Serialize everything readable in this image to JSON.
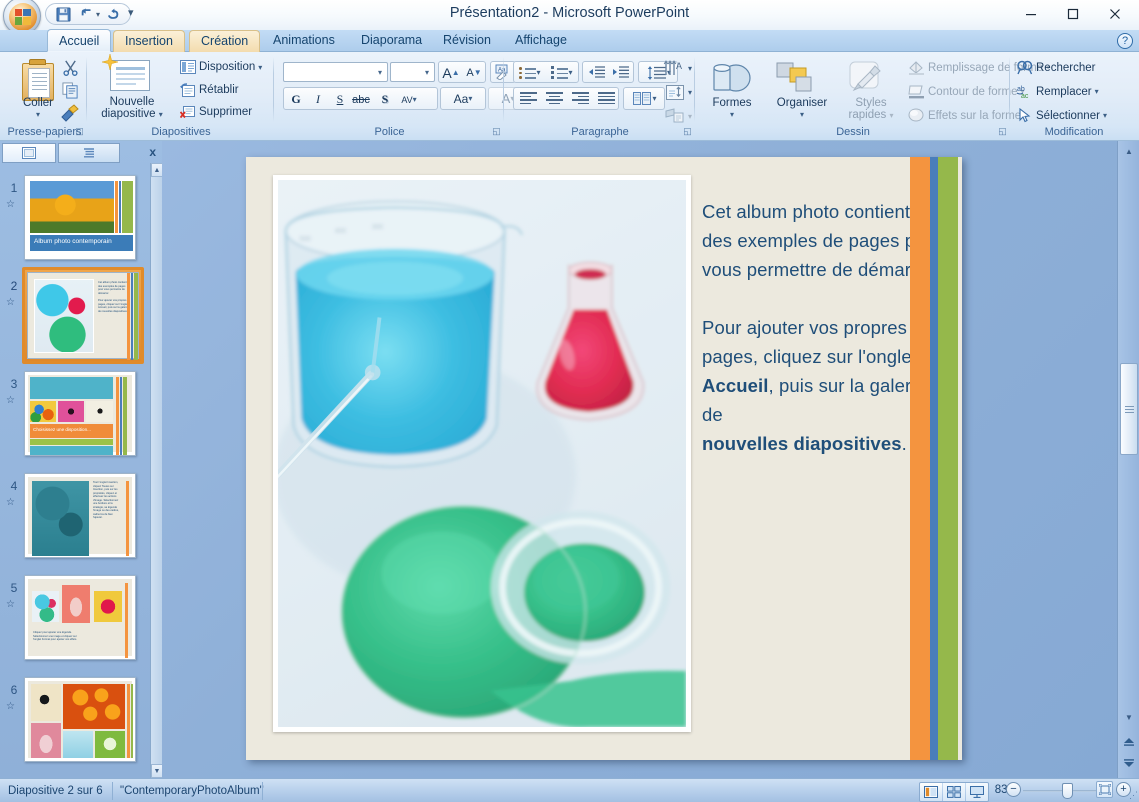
{
  "window": {
    "title": "Présentation2 - Microsoft PowerPoint",
    "minimize": "–",
    "maximize": "❐",
    "close": "✕",
    "help": "?"
  },
  "quick_access": {
    "save": "save-icon",
    "undo": "↰",
    "undo_dropdown": "▾",
    "redo": "↻",
    "customize": "▾"
  },
  "tabs": [
    {
      "label": "Accueil",
      "state": "active"
    },
    {
      "label": "Insertion",
      "state": "amber"
    },
    {
      "label": "Création",
      "state": "amber"
    },
    {
      "label": "Animations",
      "state": "normal"
    },
    {
      "label": "Diaporama",
      "state": "normal"
    },
    {
      "label": "Révision",
      "state": "normal"
    },
    {
      "label": "Affichage",
      "state": "normal"
    }
  ],
  "ribbon": {
    "groups": [
      {
        "name": "Presse-papiers",
        "label": "Presse-papiers",
        "paste": "Coller",
        "paste_caret": "▾",
        "cut": "scissors-icon",
        "copy": "copy-icon",
        "format_painter": "format-painter-icon",
        "dialog_launcher": "◱"
      },
      {
        "name": "Diapositives",
        "label": "Diapositives",
        "new_slide_line1": "Nouvelle",
        "new_slide_line2": "diapositive",
        "new_slide_caret": "▾",
        "layout": "Disposition",
        "layout_caret": "▾",
        "reset": "Rétablir",
        "delete": "Supprimer"
      },
      {
        "name": "Police",
        "label": "Police",
        "font_name_value": "",
        "font_size_value": "",
        "grow_font": "A",
        "shrink_font": "A",
        "clear_formatting": "clear-formatting-icon",
        "bold": "G",
        "italic": "I",
        "underline": "S",
        "strikethrough": "abc",
        "shadow": "S",
        "char_spacing": "AV",
        "change_case": "Aa",
        "font_color": "A",
        "dialog_launcher": "◱"
      },
      {
        "name": "Paragraphe",
        "label": "Paragraphe",
        "bullets": "bullet-list-icon",
        "numbering": "numbered-list-icon",
        "decrease_indent": "decrease-indent-icon",
        "increase_indent": "increase-indent-icon",
        "line_spacing": "line-spacing-icon",
        "align_left": "align-left-icon",
        "align_center": "align-center-icon",
        "align_right": "align-right-icon",
        "justify": "justify-icon",
        "columns": "columns-icon",
        "text_direction": "text-direction-icon",
        "align_text": "align-text-icon",
        "convert_smartart": "convert-smartart-icon",
        "dialog_launcher": "◱"
      },
      {
        "name": "Dessin",
        "label": "Dessin",
        "shapes": "Formes",
        "shapes_caret": "▾",
        "arrange": "Organiser",
        "arrange_caret": "▾",
        "quick_styles_line1": "Styles",
        "quick_styles_line2": "rapides",
        "quick_styles_caret": "▾",
        "shape_fill": "Remplissage de forme",
        "shape_outline": "Contour de forme",
        "shape_effects": "Effets sur la forme",
        "caret": "▾",
        "dialog_launcher": "◱"
      },
      {
        "name": "Modification",
        "label": "Modification",
        "find": "Rechercher",
        "replace": "Remplacer",
        "replace_caret": "▾",
        "select": "Sélectionner",
        "select_caret": "▾"
      }
    ]
  },
  "slide_panel": {
    "tab_slides": "slides-tab-icon",
    "tab_outline": "outline-tab-icon",
    "close": "x",
    "scroll_up": "▲",
    "scroll_down": "▼",
    "slides": [
      {
        "number": "1",
        "title": "Album photo contemporain",
        "selected": false
      },
      {
        "number": "2",
        "title": "",
        "selected": true
      },
      {
        "number": "3",
        "title": "Choisissez une disposition...",
        "selected": false
      },
      {
        "number": "4",
        "title": "",
        "selected": false
      },
      {
        "number": "5",
        "title": "",
        "selected": false
      },
      {
        "number": "6",
        "title": "",
        "selected": false
      }
    ]
  },
  "slide": {
    "photo_alt": "laboratory-beakers-photo",
    "body": {
      "para1_line1": "Cet album photo contient",
      "para1_line2": "des exemples de pages pour",
      "para1_line3": "vous permettre de démarrer.",
      "para2_line1": "Pour ajouter vos propres",
      "para2_line2": "pages, cliquez sur l'onglet",
      "para2_line3_bold": "Accueil",
      "para2_line3_rest": ", puis sur la galerie de",
      "para2_line4_bold": "nouvelles diapositives",
      "para2_line4_rest": "."
    },
    "stripes": {
      "background": "#ece9de",
      "orange": "#f4943f",
      "blue": "#4a7ebb",
      "green": "#95b84b"
    }
  },
  "status_bar": {
    "slide_counter": "Diapositive 2 sur 6",
    "theme_name": "\"ContemporaryPhotoAlbum\"",
    "view_normal": "normal-view-icon",
    "view_sorter": "slide-sorter-icon",
    "view_show": "slideshow-icon",
    "zoom_value": "83 %",
    "zoom_out": "−",
    "zoom_in": "+",
    "fit_to_window": "fit-slide-icon",
    "resize_grip": "⋰"
  },
  "scrollbar": {
    "up": "▲",
    "down": "▼",
    "prev_slide": "▲",
    "next_slide": "▼"
  }
}
